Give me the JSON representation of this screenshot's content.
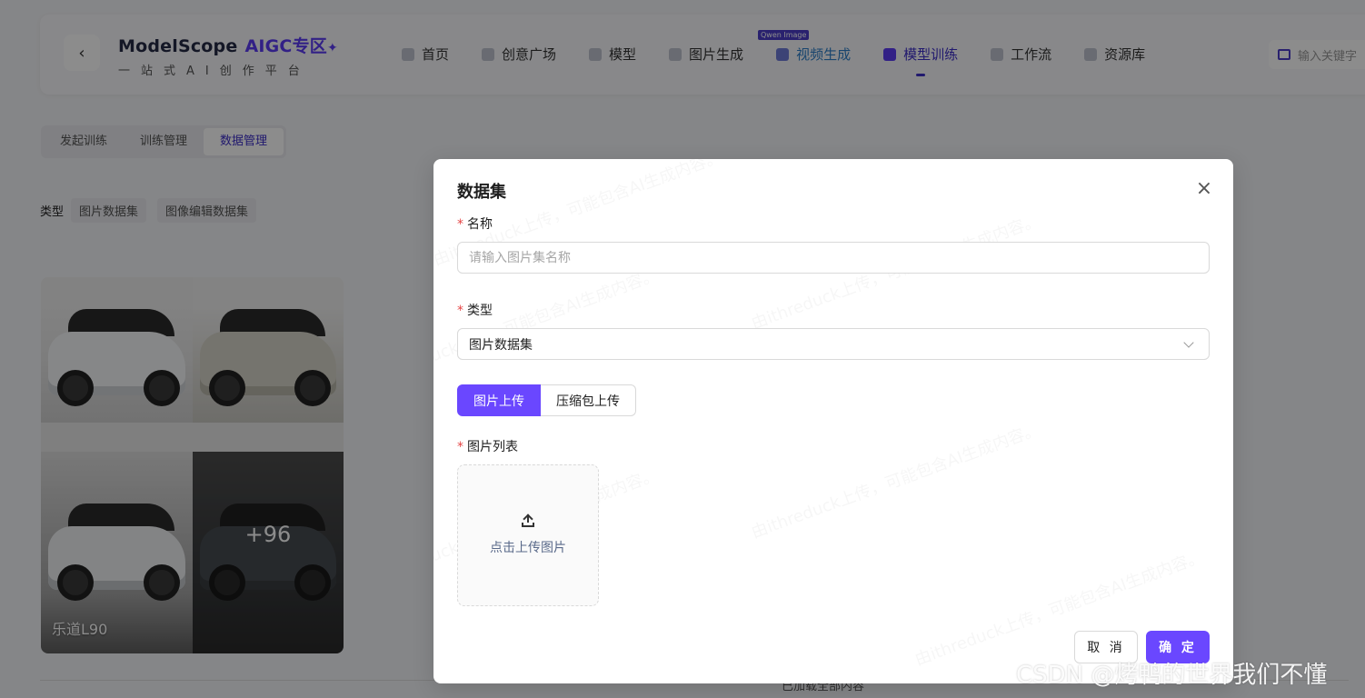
{
  "header": {
    "back_icon": "chevron-left-icon",
    "brand_name": "ModelScope",
    "brand_aigc": "AIGC专区",
    "brand_spark": "✦",
    "brand_sub": "一站式AI创作平台",
    "nav": [
      {
        "label": "首页",
        "icon": "home-icon"
      },
      {
        "label": "创意广场",
        "icon": "flask-icon"
      },
      {
        "label": "模型",
        "icon": "cube-icon"
      },
      {
        "label": "图片生成",
        "icon": "image-icon"
      },
      {
        "label": "视频生成",
        "icon": "video-icon"
      },
      {
        "label": "模型训练",
        "icon": "train-icon"
      },
      {
        "label": "工作流",
        "icon": "workflow-icon"
      },
      {
        "label": "资源库",
        "icon": "library-icon"
      }
    ],
    "nav_badge": "Qwen Image",
    "active_nav": "模型训练",
    "search_placeholder": "输入关键字"
  },
  "subtabs": [
    "发起训练",
    "训练管理",
    "数据管理"
  ],
  "active_subtab": "数据管理",
  "types": {
    "label": "类型",
    "chips": [
      "图片数据集",
      "图像编辑数据集"
    ]
  },
  "card": {
    "title": "乐道L90",
    "more": "+96"
  },
  "footer_text": "已加载全部内容",
  "modal": {
    "title": "数据集",
    "close_icon": "close-icon",
    "name_label": "名称",
    "name_placeholder": "请输入图片集名称",
    "type_label": "类型",
    "type_value": "图片数据集",
    "upload_modes": [
      "图片上传",
      "压缩包上传"
    ],
    "active_upload_mode": "图片上传",
    "images_label": "图片列表",
    "upload_text": "点击上传图片",
    "watermark": "由ithreduck上传，可能包含AI生成内容。",
    "cancel_label": "取 消",
    "ok_label": "确 定"
  },
  "watermark_credit": "CSDN @烤鸭的世界我们不懂",
  "colors": {
    "accent": "#6a47ff",
    "nav_active": "#3d2ec9",
    "required": "#e54545",
    "mask": "rgba(0,0,0,0.45)"
  }
}
